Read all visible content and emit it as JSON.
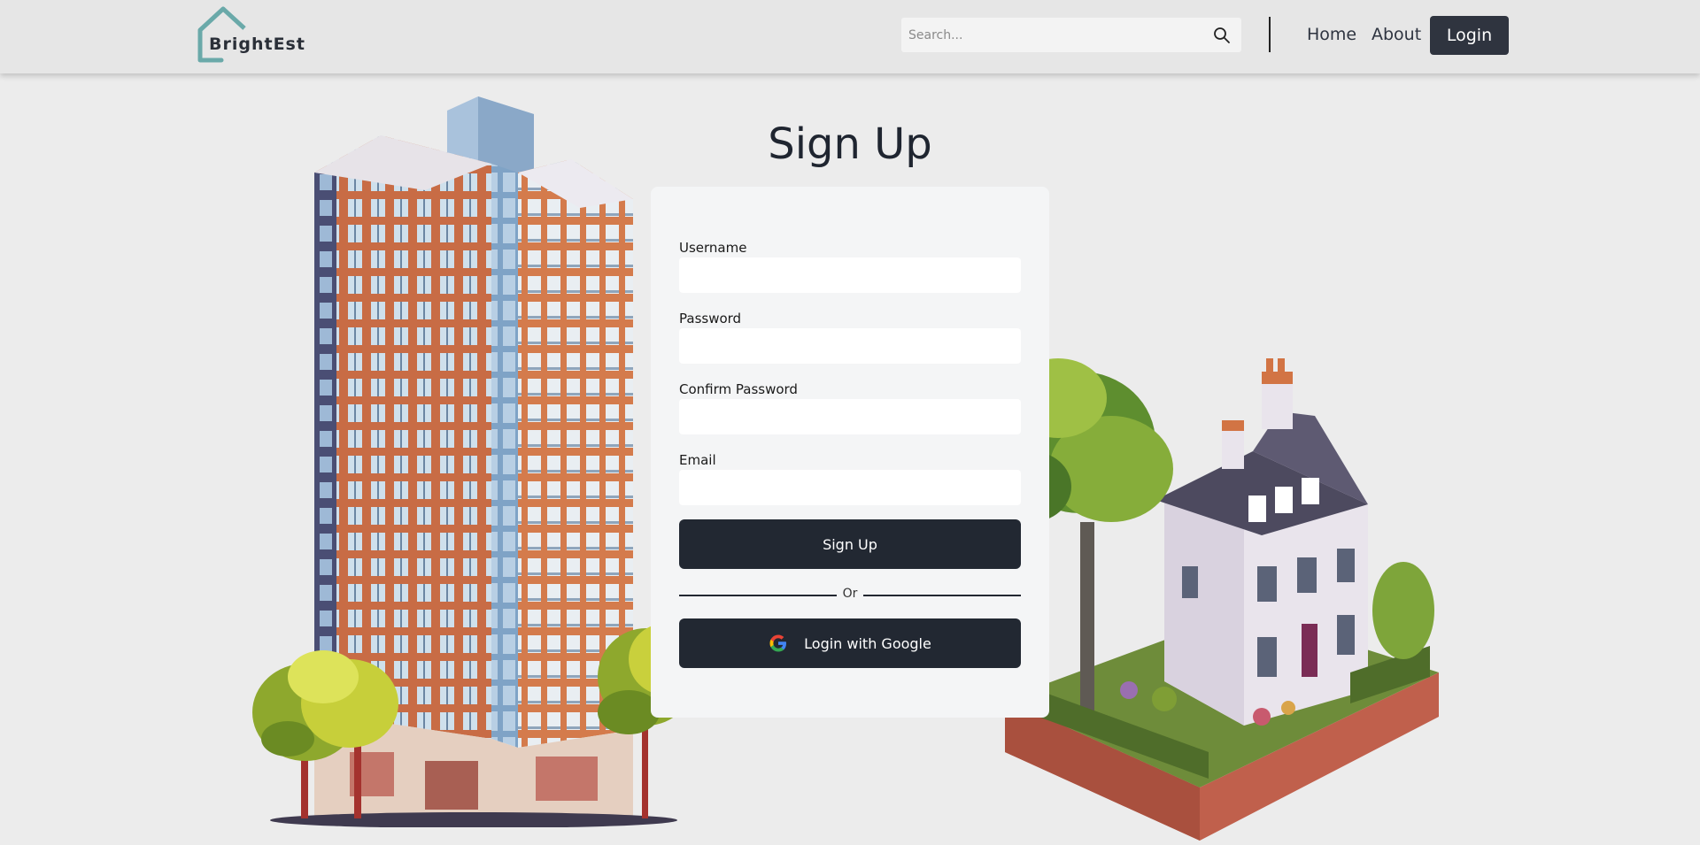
{
  "header": {
    "logo_text": "BrightEst",
    "search_placeholder": "Search...",
    "nav": {
      "home": "Home",
      "about": "About",
      "login": "Login"
    }
  },
  "page": {
    "title": "Sign Up"
  },
  "form": {
    "username_label": "Username",
    "password_label": "Password",
    "confirm_password_label": "Confirm Password",
    "email_label": "Email",
    "submit_label": "Sign Up",
    "divider_text": "Or",
    "google_label": "Login with Google"
  },
  "colors": {
    "accent_dark": "#222832",
    "logo_teal": "#6aa9a9",
    "background": "#ececec"
  },
  "icons": [
    "house-logo-icon",
    "search-icon",
    "google-icon"
  ]
}
